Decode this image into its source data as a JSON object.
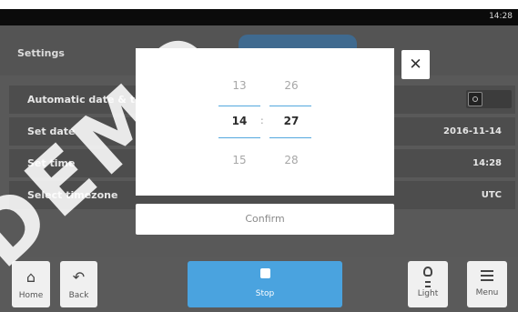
{
  "status_bar": {
    "clock": "14:28"
  },
  "settings": {
    "title": "Settings",
    "rows": [
      {
        "label": "Automatic date & time"
      },
      {
        "label": "Set date",
        "value": "2016-11-14"
      },
      {
        "label": "Set time",
        "value": "14:28"
      },
      {
        "label": "Select timezone",
        "value": "UTC"
      }
    ]
  },
  "time_picker": {
    "hours": {
      "prev": "13",
      "current": "14",
      "next": "15"
    },
    "separator": ":",
    "minutes": {
      "prev": "26",
      "current": "27",
      "next": "28"
    },
    "confirm_label": "Confirm",
    "close_glyph": "✕"
  },
  "nav": {
    "home": {
      "label": "Home",
      "icon": "home-icon"
    },
    "back": {
      "label": "Back",
      "icon": "back-arrow-icon"
    },
    "stop": {
      "label": "Stop",
      "icon": "stop-icon",
      "color": "#4aa3df"
    },
    "light": {
      "label": "Light",
      "icon": "lightbulb-icon"
    },
    "menu": {
      "label": "Menu",
      "icon": "menu-icon"
    }
  },
  "watermark": {
    "text": "DEMO"
  }
}
